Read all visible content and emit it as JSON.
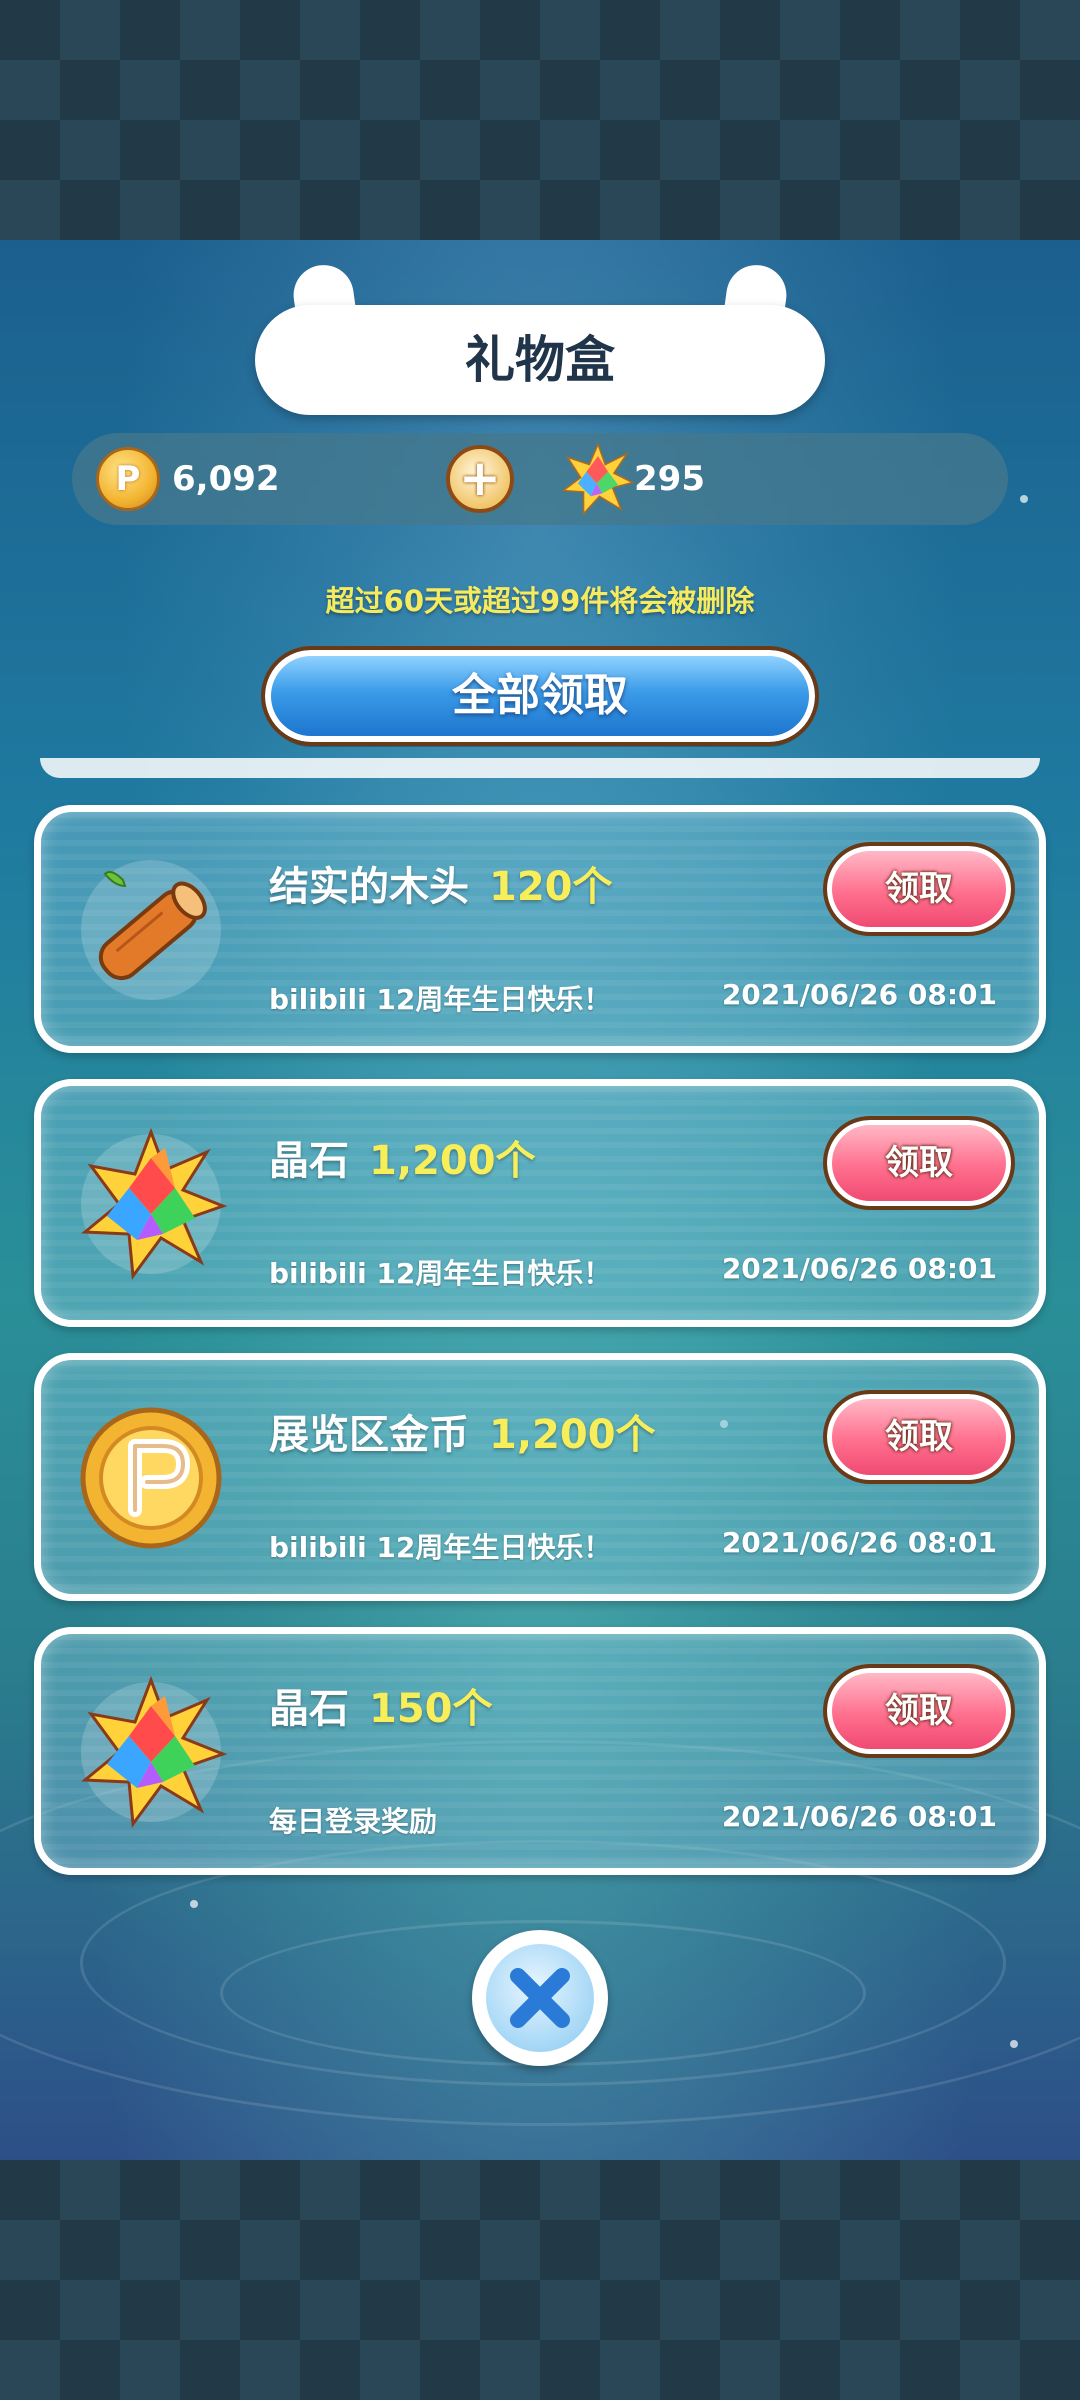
{
  "title": "礼物盒",
  "currency": {
    "coins": "6,092",
    "plus_label": "+",
    "gems": "295",
    "coin_icon_letter": "P"
  },
  "notice": "超过60天或超过99件将会被删除",
  "claim_all_label": "全部领取",
  "gifts": [
    {
      "name": "结实的木头",
      "qty": "120个",
      "source": "bilibili 12周年生日快乐！",
      "date": "2021/06/26  08:01",
      "icon": "wood-log-icon",
      "button": "领取"
    },
    {
      "name": "晶石",
      "qty": "1,200个",
      "source": "bilibili 12周年生日快乐！",
      "date": "2021/06/26  08:01",
      "icon": "crystal-gem-icon",
      "button": "领取"
    },
    {
      "name": "展览区金币",
      "qty": "1,200个",
      "source": "bilibili 12周年生日快乐！",
      "date": "2021/06/26  08:01",
      "icon": "pavilion-coin-icon",
      "button": "领取"
    },
    {
      "name": "晶石",
      "qty": "150个",
      "source": "每日登录奖励",
      "date": "2021/06/26  08:01",
      "icon": "crystal-gem-icon",
      "button": "领取"
    }
  ],
  "colors": {
    "accent_yellow": "#f7ee5a",
    "claim_pink": "#ff6f8e",
    "claim_all_blue": "#3a9be8",
    "title_text": "#20354a"
  }
}
